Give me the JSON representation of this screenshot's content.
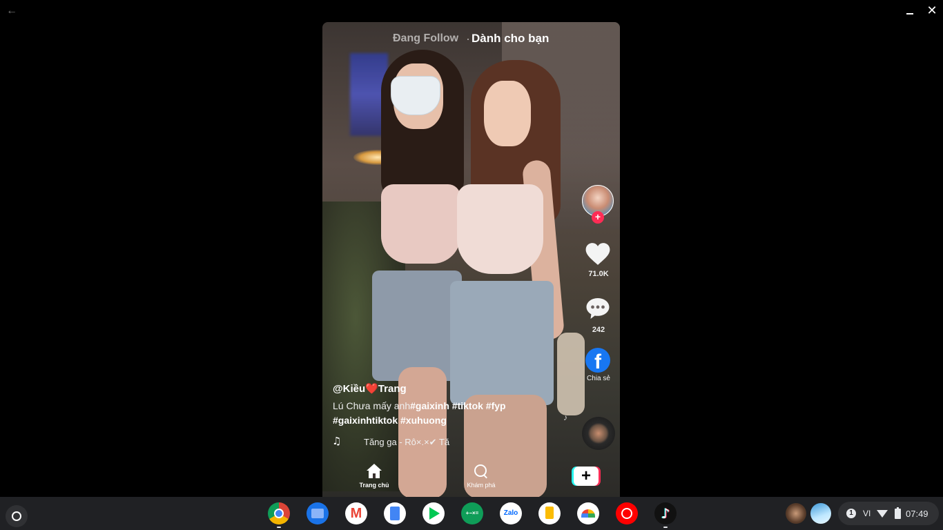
{
  "window": {
    "back_icon": "arrow-left-icon",
    "minimize_icon": "minimize-icon",
    "close_icon": "close-icon",
    "back_glyph": "←",
    "close_glyph": "✕"
  },
  "feed_tabs": {
    "following": "Đang Follow",
    "for_you": "Dành cho bạn"
  },
  "actions": {
    "likes": "71.0K",
    "comments": "242",
    "share_label": "Chia sẻ",
    "follow_plus": "+"
  },
  "post": {
    "username": "@Kiều❤️Trang",
    "caption_text": "Lú Chưa mấy anh",
    "caption_tags_line1": "#gaixinh #tiktok #fyp",
    "caption_tags_line2": "#gaixinhtiktok #xuhuong",
    "sound": "Tăng ga - Rô×.×✔  Tă",
    "sound_glyph": "♫",
    "floating_note": "♪"
  },
  "bottom_nav": {
    "home": "Trang chủ",
    "explore": "Khám phá",
    "create": "+"
  },
  "shelf": {
    "apps": [
      "Chrome",
      "Files",
      "Gmail",
      "Docs",
      "Play Store",
      "Calculator",
      "Zalo",
      "Keep",
      "Photos",
      "YouTube Music",
      "TikTok"
    ],
    "notification_count": "1",
    "language": "VI",
    "time": "07:49"
  },
  "colors": {
    "tiktok_red": "#fe2c55",
    "tiktok_cyan": "#25f4ee",
    "facebook_blue": "#1877f2",
    "shelf_bg": "#202124"
  }
}
